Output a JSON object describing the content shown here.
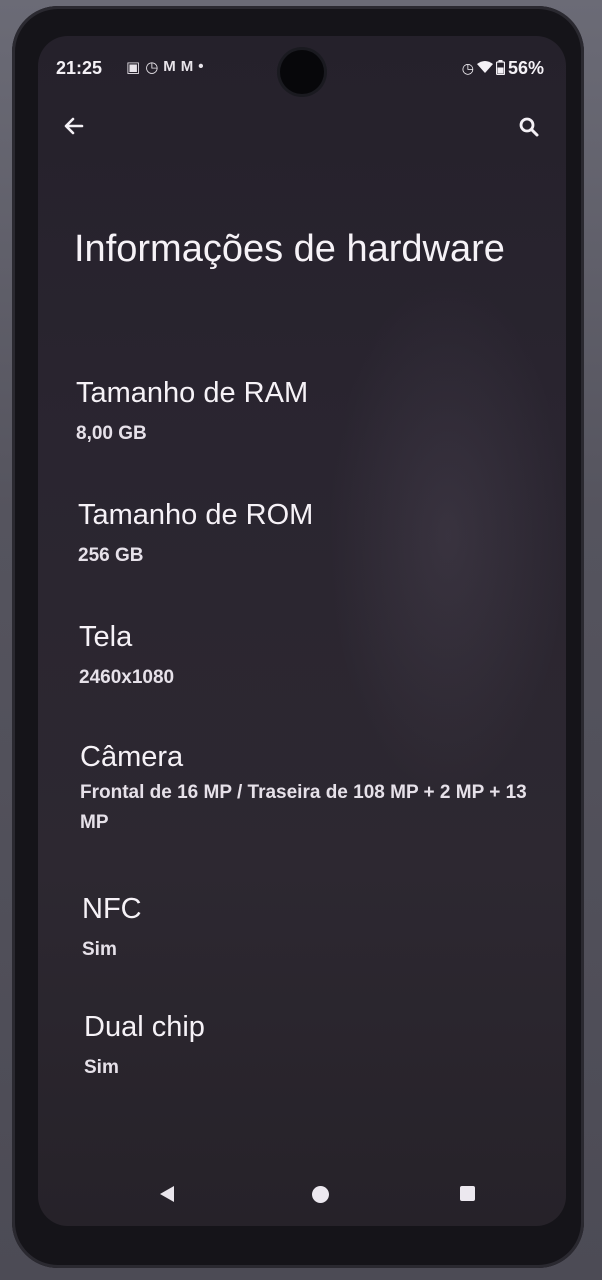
{
  "status_bar": {
    "time": "21:25",
    "left_icons": [
      "sim-card-icon",
      "alarm-icon",
      "gmail-icon",
      "gmail-icon",
      "dot-icon"
    ],
    "right_icons": [
      "alarm-icon",
      "wifi-icon",
      "battery-icon"
    ],
    "battery": "56%"
  },
  "top_bar": {
    "back_icon": "arrow-left-icon",
    "search_icon": "search-icon"
  },
  "page": {
    "title": "Informações de hardware"
  },
  "items": [
    {
      "label": "Tamanho de RAM",
      "value": "8,00 GB"
    },
    {
      "label": "Tamanho de ROM",
      "value": "256 GB"
    },
    {
      "label": "Tela",
      "value": "2460x1080"
    },
    {
      "label": "Câmera",
      "value": "Frontal de 16 MP / Traseira de 108 MP + 2 MP + 13 MP"
    },
    {
      "label": "NFC",
      "value": "Sim"
    },
    {
      "label": "Dual chip",
      "value": "Sim"
    }
  ],
  "nav_bar": {
    "back_icon": "triangle-back-icon",
    "home_icon": "circle-home-icon",
    "recents_icon": "square-recents-icon"
  },
  "colors": {
    "background": "#2a2530",
    "text": "#f6f2f7",
    "secondary_text": "#e6e1e9"
  }
}
